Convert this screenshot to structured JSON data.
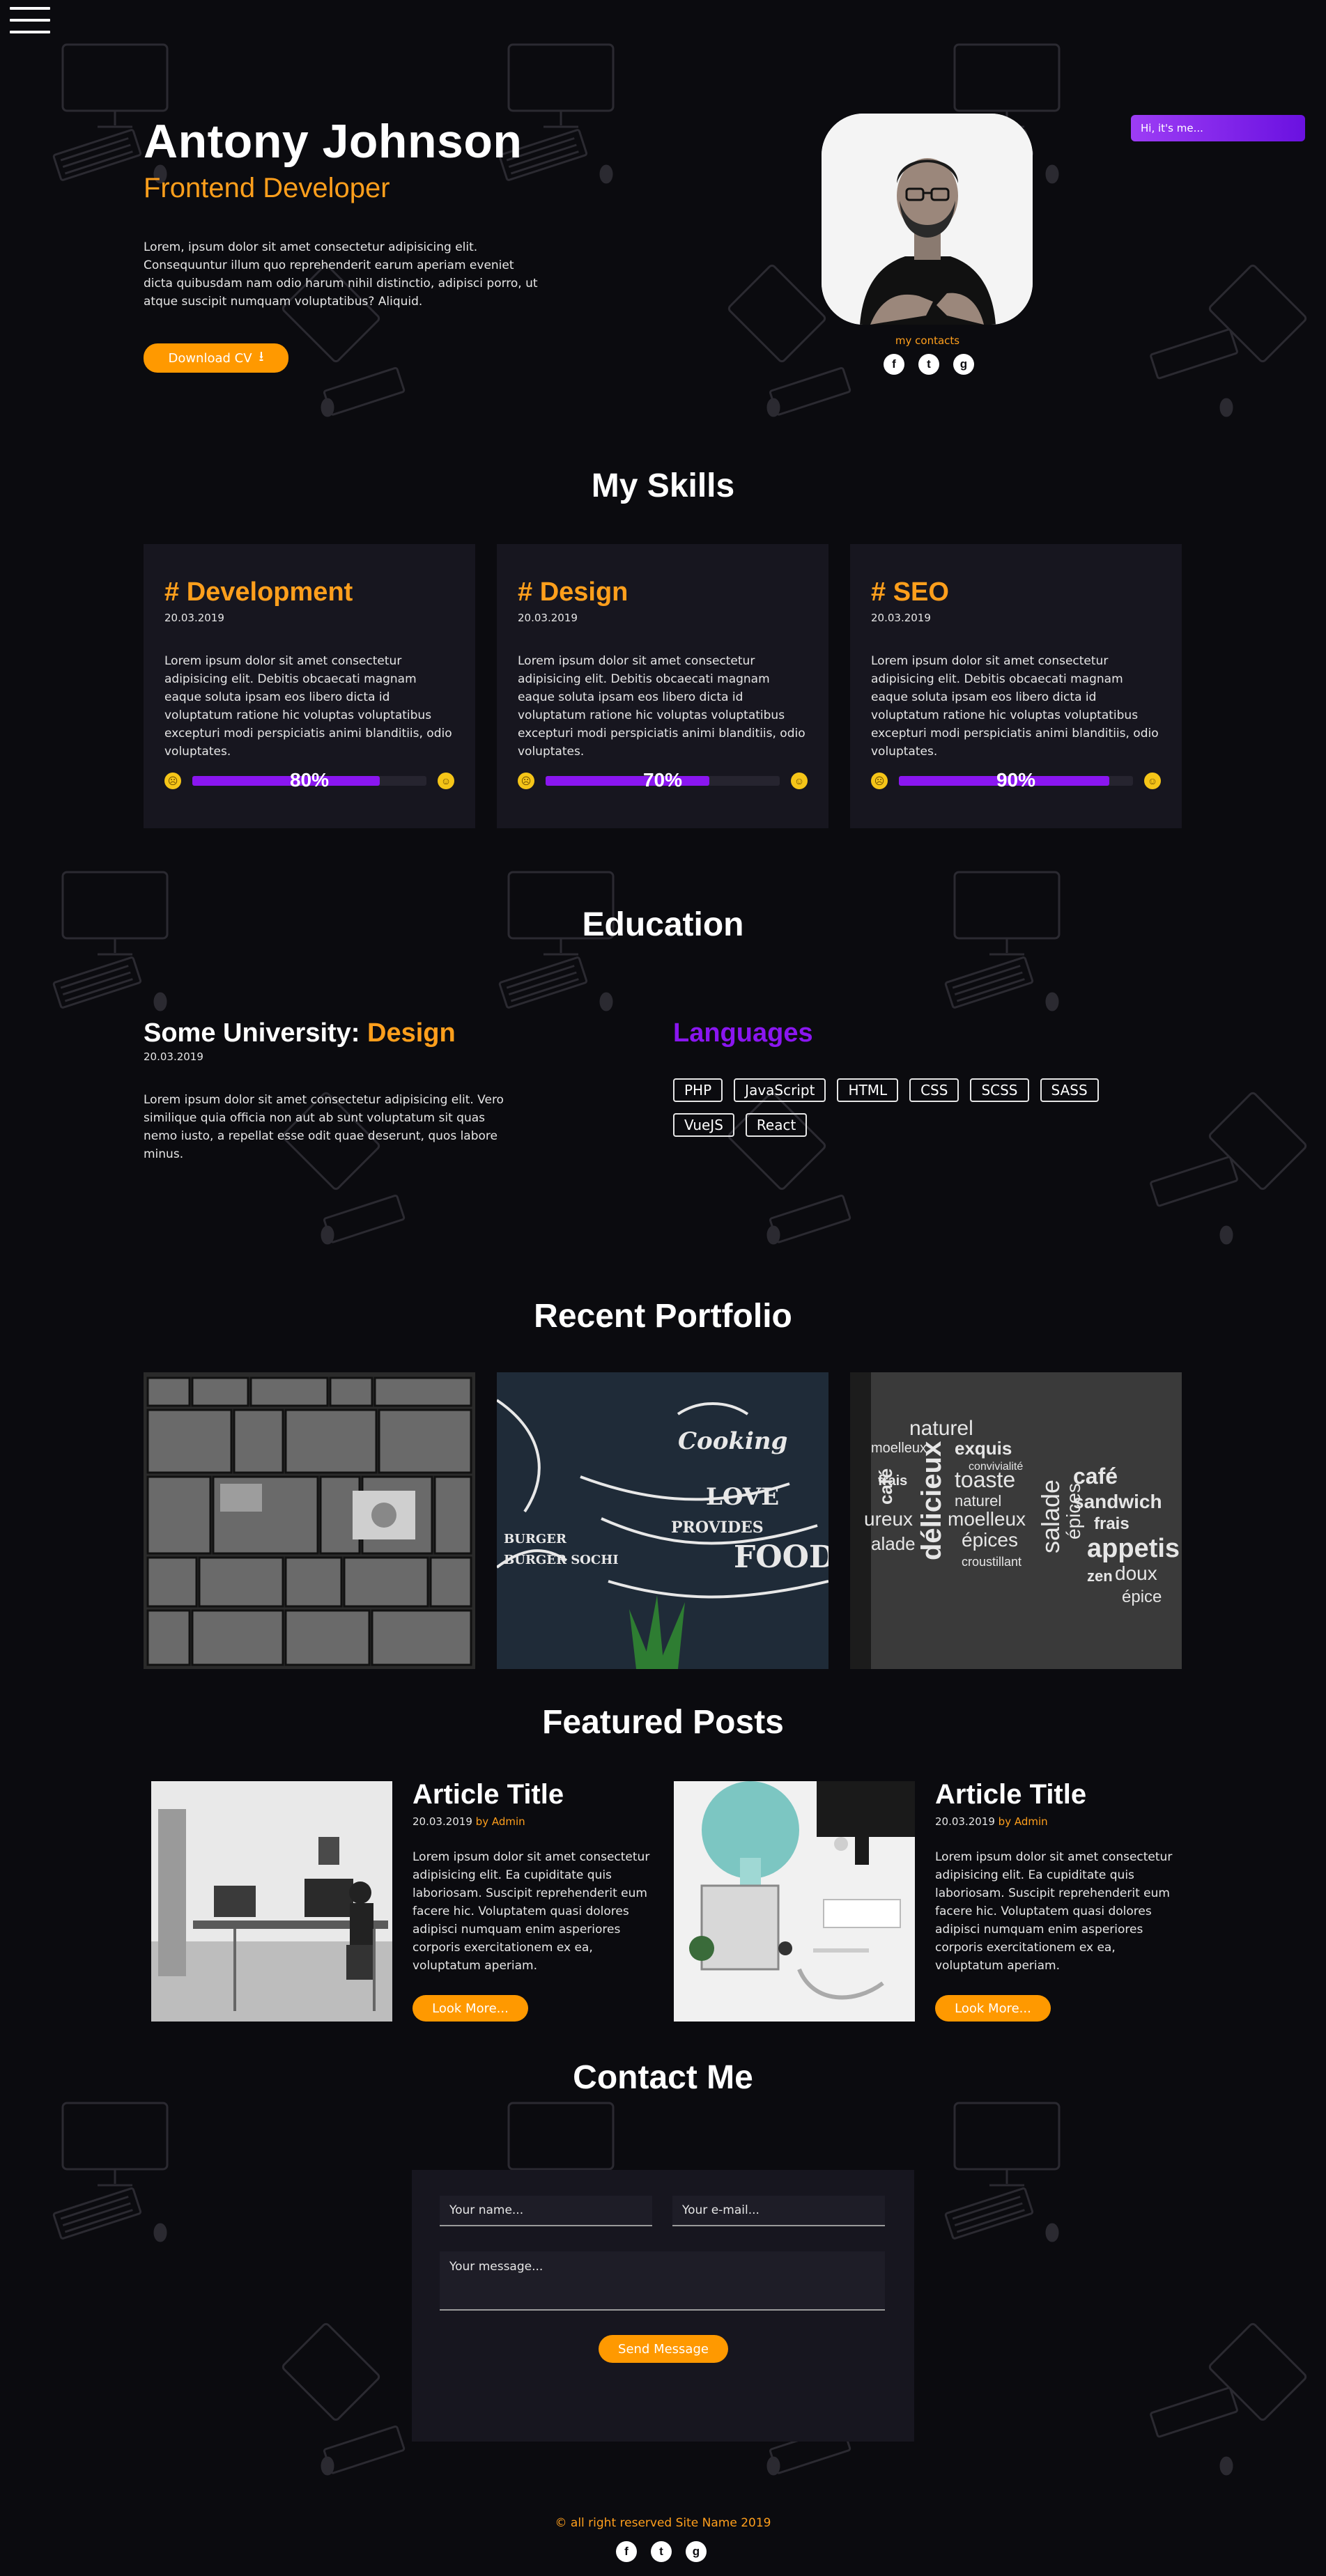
{
  "hero": {
    "name": "Antony Johnson",
    "role": "Frontend Developer",
    "description": "Lorem, ipsum dolor sit amet consectetur adipisicing elit. Consequuntur illum quo reprehenderit earum aperiam eveniet dicta quibusdam nam odio harum nihil distinctio, adipisci porro, ut atque suscipit numquam voluptatibus? Aliquid.",
    "download_label": "Download CV",
    "contacts_label": "my contacts",
    "badge": "Hi, it's me..."
  },
  "socials": [
    {
      "icon": "facebook-icon",
      "glyph": "f"
    },
    {
      "icon": "twitter-icon",
      "glyph": "t"
    },
    {
      "icon": "github-icon",
      "glyph": "g"
    }
  ],
  "skills": {
    "title": "My Skills",
    "items": [
      {
        "title": "# Development",
        "date": "20.03.2019",
        "text": "Lorem ipsum dolor sit amet consectetur adipisicing elit. Debitis obcaecati magnam eaque soluta ipsam eos libero dicta id voluptatum ratione hic voluptas voluptatibus excepturi modi perspiciatis animi blanditiis, odio voluptates.",
        "percent": 80,
        "percent_label": "80%"
      },
      {
        "title": "# Design",
        "date": "20.03.2019",
        "text": "Lorem ipsum dolor sit amet consectetur adipisicing elit. Debitis obcaecati magnam eaque soluta ipsam eos libero dicta id voluptatum ratione hic voluptas voluptatibus excepturi modi perspiciatis animi blanditiis, odio voluptates.",
        "percent": 70,
        "percent_label": "70%"
      },
      {
        "title": "# SEO",
        "date": "20.03.2019",
        "text": "Lorem ipsum dolor sit amet consectetur adipisicing elit. Debitis obcaecati magnam eaque soluta ipsam eos libero dicta id voluptatum ratione hic voluptas voluptatibus excepturi modi perspiciatis animi blanditiis, odio voluptates.",
        "percent": 90,
        "percent_label": "90%"
      }
    ]
  },
  "education": {
    "title": "Education",
    "university_prefix": "Some University: ",
    "university_accent": "Design",
    "date": "20.03.2019",
    "text": "Lorem ipsum dolor sit amet consectetur adipisicing elit. Vero similique quia officia non aut ab sunt voluptatum sit quas nemo iusto, a repellat esse odit quae deserunt, quos labore minus.",
    "languages_title": "Languages",
    "languages": [
      "PHP",
      "JavaScript",
      "HTML",
      "CSS",
      "SCSS",
      "SASS",
      "VueJS",
      "React"
    ]
  },
  "portfolio": {
    "title": "Recent Portfolio"
  },
  "posts": {
    "title": "Featured Posts",
    "items": [
      {
        "title": "Article Title",
        "date": "20.03.2019",
        "by": "by Admin",
        "text": "Lorem ipsum dolor sit amet consectetur adipisicing elit. Ea cupiditate quis laboriosam. Suscipit reprehenderit eum facere hic. Voluptatem quasi dolores adipisci numquam enim asperiores corporis exercitationem ex ea, voluptatum aperiam.",
        "button": "Look More..."
      },
      {
        "title": "Article Title",
        "date": "20.03.2019",
        "by": "by Admin",
        "text": "Lorem ipsum dolor sit amet consectetur adipisicing elit. Ea cupiditate quis laboriosam. Suscipit reprehenderit eum facere hic. Voluptatem quasi dolores adipisci numquam enim asperiores corporis exercitationem ex ea, voluptatum aperiam.",
        "button": "Look More..."
      }
    ]
  },
  "contact": {
    "title": "Contact Me",
    "name_placeholder": "Your name...",
    "email_placeholder": "Your e-mail...",
    "message_placeholder": "Your message...",
    "send_label": "Send Message"
  },
  "footer": {
    "copyright": "© all right reserved Site Name 2019"
  },
  "colors": {
    "background": "#0b0b0f",
    "card": "#17161f",
    "accent_orange": "#ff9f1c",
    "accent_purple": "#8a16f0"
  }
}
